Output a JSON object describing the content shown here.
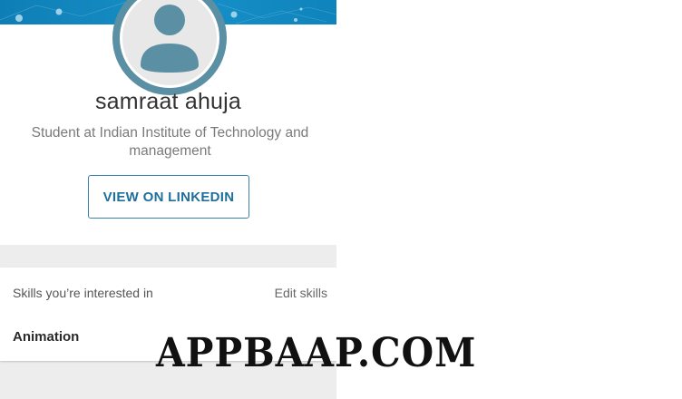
{
  "profile": {
    "name": "samraat ahuja",
    "headline_line1": "Student at Indian Institute of Technology and",
    "headline_line2": "management",
    "view_button_label": "VIEW ON LINKEDIN"
  },
  "skills": {
    "header": "Skills you’re interested in",
    "edit_label": "Edit skills",
    "items": [
      "Animation"
    ]
  },
  "watermark": "APPBAAP.COM",
  "colors": {
    "banner": "#1790c8",
    "avatar_ring": "#5b8fa3",
    "button_border": "#3a83ad",
    "button_text": "#1f6f9b",
    "page_background": "#ededed"
  }
}
